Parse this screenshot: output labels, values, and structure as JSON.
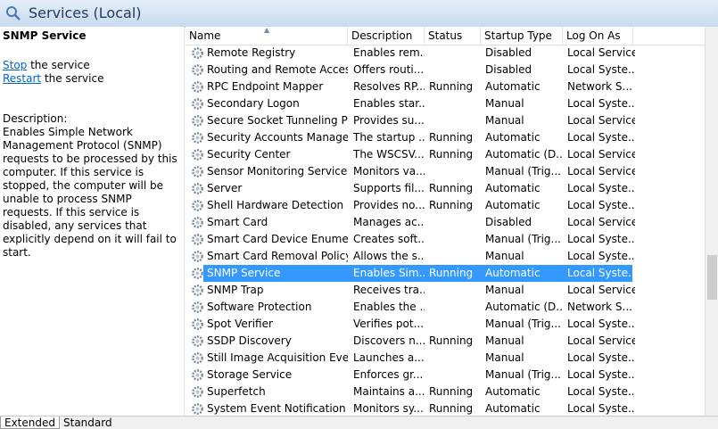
{
  "window": {
    "title": "Services (Local)"
  },
  "left_panel": {
    "service_name": "SNMP Service",
    "actions": [
      {
        "link": "Stop",
        "suffix": " the service"
      },
      {
        "link": "Restart",
        "suffix": " the service"
      }
    ],
    "description_label": "Description:",
    "description": "Enables Simple Network Management Protocol (SNMP) requests to be processed by this computer. If this service is stopped, the computer will be unable to process SNMP requests. If this service is disabled, any services that explicitly depend on it will fail to start."
  },
  "columns": [
    "Name",
    "Description",
    "Status",
    "Startup Type",
    "Log On As"
  ],
  "rows": [
    [
      "Remote Registry",
      "Enables rem...",
      "",
      "Disabled",
      "Local Service"
    ],
    [
      "Routing and Remote Access",
      "Offers routi...",
      "",
      "Disabled",
      "Local Syste..."
    ],
    [
      "RPC Endpoint Mapper",
      "Resolves RP...",
      "Running",
      "Automatic",
      "Network S..."
    ],
    [
      "Secondary Logon",
      "Enables star...",
      "",
      "Manual",
      "Local Syste..."
    ],
    [
      "Secure Socket Tunneling Pr...",
      "Provides su...",
      "",
      "Manual",
      "Local Service"
    ],
    [
      "Security Accounts Manager",
      "The startup ...",
      "Running",
      "Automatic",
      "Local Syste..."
    ],
    [
      "Security Center",
      "The WSCSV...",
      "Running",
      "Automatic (D...",
      "Local Service"
    ],
    [
      "Sensor Monitoring Service",
      "Monitors va...",
      "",
      "Manual (Trig...",
      "Local Service"
    ],
    [
      "Server",
      "Supports fil...",
      "Running",
      "Automatic",
      "Local Syste..."
    ],
    [
      "Shell Hardware Detection",
      "Provides no...",
      "Running",
      "Automatic",
      "Local Syste..."
    ],
    [
      "Smart Card",
      "Manages ac...",
      "",
      "Disabled",
      "Local Service"
    ],
    [
      "Smart Card Device Enumera...",
      "Creates soft...",
      "",
      "Manual (Trig...",
      "Local Syste..."
    ],
    [
      "Smart Card Removal Policy",
      "Allows the s...",
      "",
      "Manual",
      "Local Syste..."
    ],
    [
      "SNMP Service",
      "Enables Sim...",
      "Running",
      "Automatic",
      "Local Syste..."
    ],
    [
      "SNMP Trap",
      "Receives tra...",
      "",
      "Manual",
      "Local Service"
    ],
    [
      "Software Protection",
      "Enables the ...",
      "",
      "Automatic (D...",
      "Network S..."
    ],
    [
      "Spot Verifier",
      "Verifies pot...",
      "",
      "Manual (Trig...",
      "Local Syste..."
    ],
    [
      "SSDP Discovery",
      "Discovers n...",
      "Running",
      "Manual",
      "Local Service"
    ],
    [
      "Still Image Acquisition Events",
      "Launches a...",
      "",
      "Manual",
      "Local Syste..."
    ],
    [
      "Storage Service",
      "Enforces gr...",
      "",
      "Manual (Trig...",
      "Local Syste..."
    ],
    [
      "Superfetch",
      "Maintains a...",
      "Running",
      "Automatic",
      "Local Syste..."
    ],
    [
      "System Event Notification S...",
      "Monitors sy...",
      "Running",
      "Automatic",
      "Local Syste..."
    ]
  ],
  "selected_row": 13,
  "tabs": [
    "Extended",
    "Standard"
  ],
  "active_tab": 0,
  "colors": {
    "selection": "#3399ff",
    "link": "#0066cc",
    "title": "#1e395b"
  }
}
